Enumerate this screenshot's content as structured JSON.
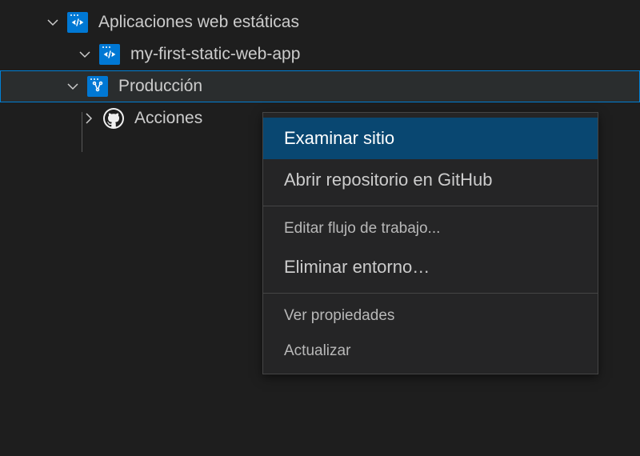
{
  "tree": {
    "root": {
      "label": "Aplicaciones web estáticas"
    },
    "app": {
      "label": "my-first-static-web-app"
    },
    "env": {
      "label": "Producción"
    },
    "actions": {
      "label": "Acciones"
    }
  },
  "menu": {
    "browse_site": "Examinar sitio",
    "open_repo": "Abrir repositorio en GitHub",
    "edit_workflow": "Editar flujo de trabajo...",
    "delete_env": "Eliminar entorno…",
    "view_props": "Ver propiedades",
    "refresh": "Actualizar"
  },
  "colors": {
    "accent": "#0078d4",
    "selection": "#094771",
    "outline": "#007fd4"
  }
}
